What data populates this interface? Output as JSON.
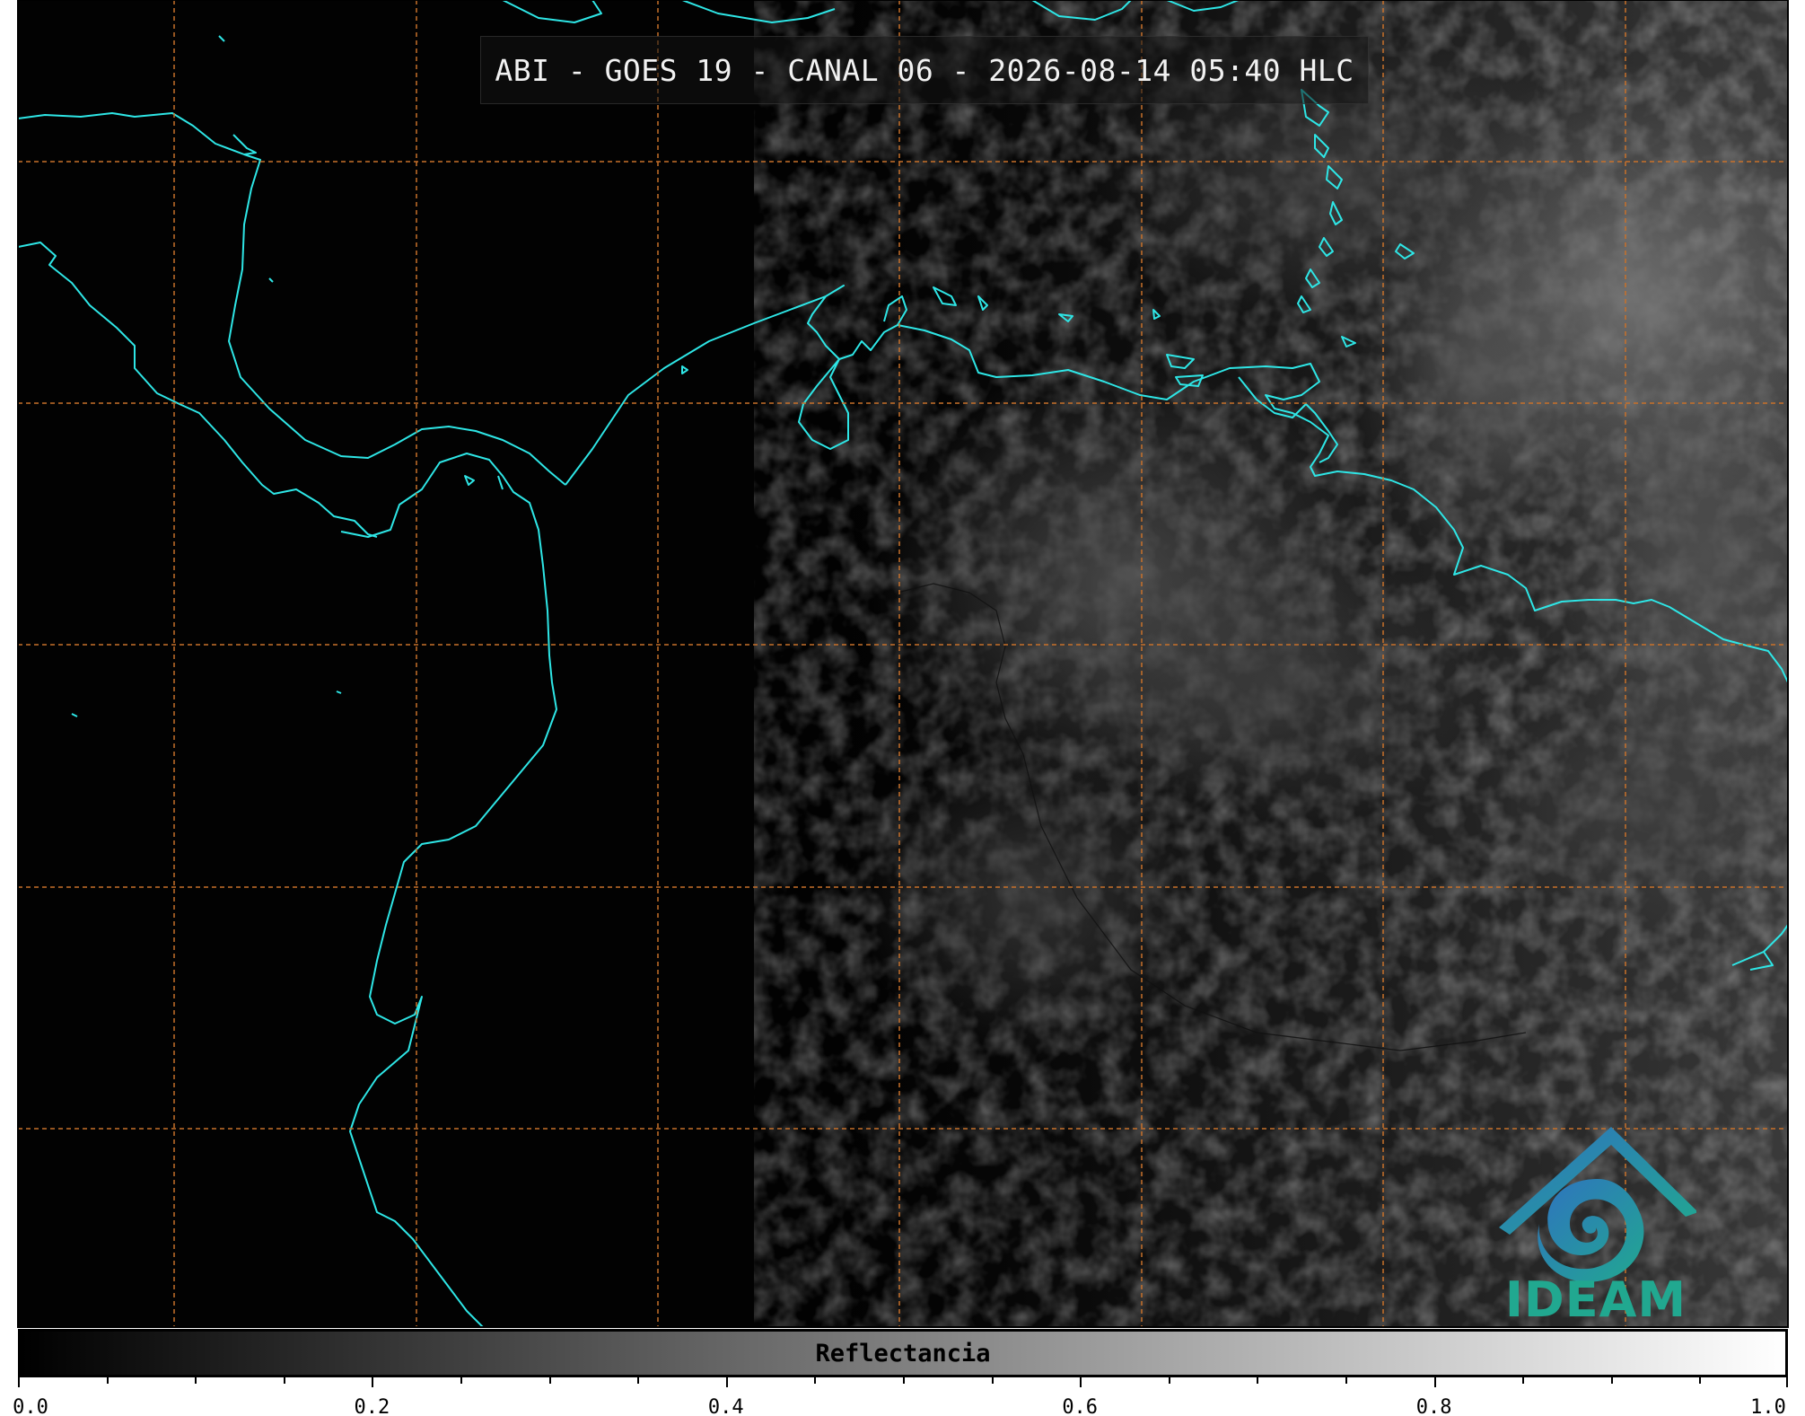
{
  "title": "ABI - GOES 19 - CANAL 06 - 2026-08-14 05:40 HLC",
  "colors": {
    "coastline": "#2ee6e6",
    "graticule": "#c8712a",
    "logo_blue": "#2f72c0",
    "logo_green": "#21a890"
  },
  "logo": {
    "text": "IDEAM",
    "icon": "ideam-logo-icon"
  },
  "colorbar": {
    "label": "Reflectancia",
    "min": 0.0,
    "max": 1.0,
    "colormap": "gray",
    "tick_labels": [
      "0.0",
      "0.2",
      "0.4",
      "0.6",
      "0.8",
      "1.0"
    ],
    "minor_ticks_per_major": 4
  }
}
